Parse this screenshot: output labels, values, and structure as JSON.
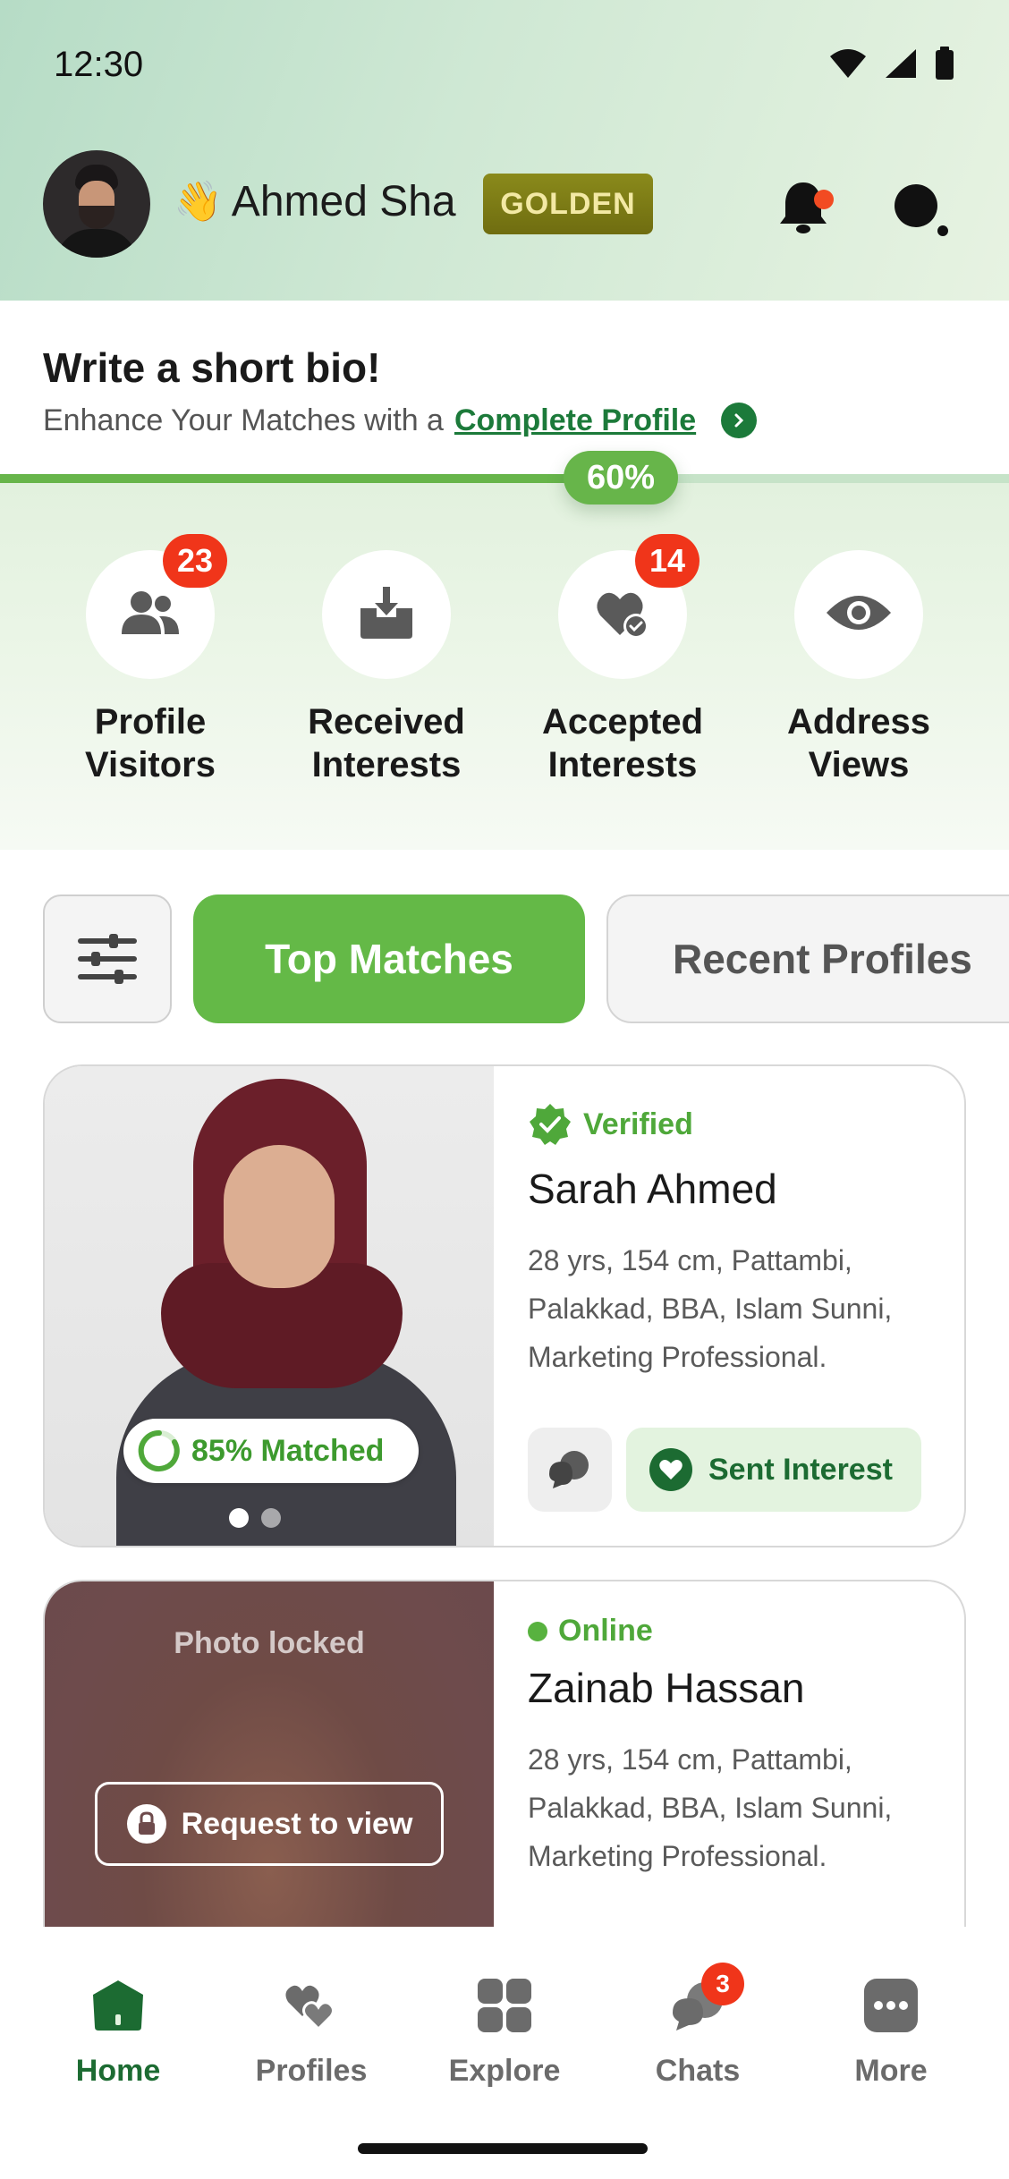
{
  "status_bar": {
    "time": "12:30"
  },
  "header": {
    "user_name": "Ahmed Sha",
    "wave_emoji": "👋",
    "badge": "GOLDEN",
    "icons": {
      "notification": "bell-icon",
      "search": "search-icon"
    }
  },
  "bio": {
    "title": "Write a short bio!",
    "subtitle": "Enhance Your Matches with a",
    "link": "Complete Profile",
    "progress_percent": 60,
    "progress_label": "60%"
  },
  "stats": [
    {
      "id": "profile-visitors",
      "label": "Profile Visitors",
      "badge": "23",
      "icon": "people-icon"
    },
    {
      "id": "received-interests",
      "label": "Received Interests",
      "badge": "",
      "icon": "inbox-download-icon"
    },
    {
      "id": "accepted-interests",
      "label": "Accepted Interests",
      "badge": "14",
      "icon": "heart-check-icon"
    },
    {
      "id": "address-views",
      "label": "Address Views",
      "badge": "",
      "icon": "eye-icon"
    }
  ],
  "tabs": {
    "filter_icon": "sliders-icon",
    "top_matches": "Top Matches",
    "recent_profiles": "Recent Profiles"
  },
  "profiles": [
    {
      "status": "Verified",
      "name": "Sarah Ahmed",
      "details": "28 yrs, 154 cm, Pattambi, Palakkad, BBA, Islam Sunni, Marketing Professional.",
      "match": "85% Matched",
      "match_percent": 85,
      "action": "Sent Interest"
    },
    {
      "status": "Online",
      "name": "Zainab Hassan",
      "details": "28 yrs, 154 cm, Pattambi, Palakkad, BBA, Islam Sunni, Marketing Professional.",
      "locked_label": "Photo locked",
      "request_label": "Request to view"
    }
  ],
  "nav": [
    {
      "label": "Home",
      "icon": "home-icon",
      "active": true
    },
    {
      "label": "Profiles",
      "icon": "hearts-icon"
    },
    {
      "label": "Explore",
      "icon": "grid-icon"
    },
    {
      "label": "Chats",
      "icon": "chat-icon",
      "badge": "3"
    },
    {
      "label": "More",
      "icon": "more-icon"
    }
  ],
  "colors": {
    "brand_green": "#64b947",
    "dark_green": "#1c6b32",
    "badge_red": "#f0351a",
    "gold": "#7d7a14"
  }
}
